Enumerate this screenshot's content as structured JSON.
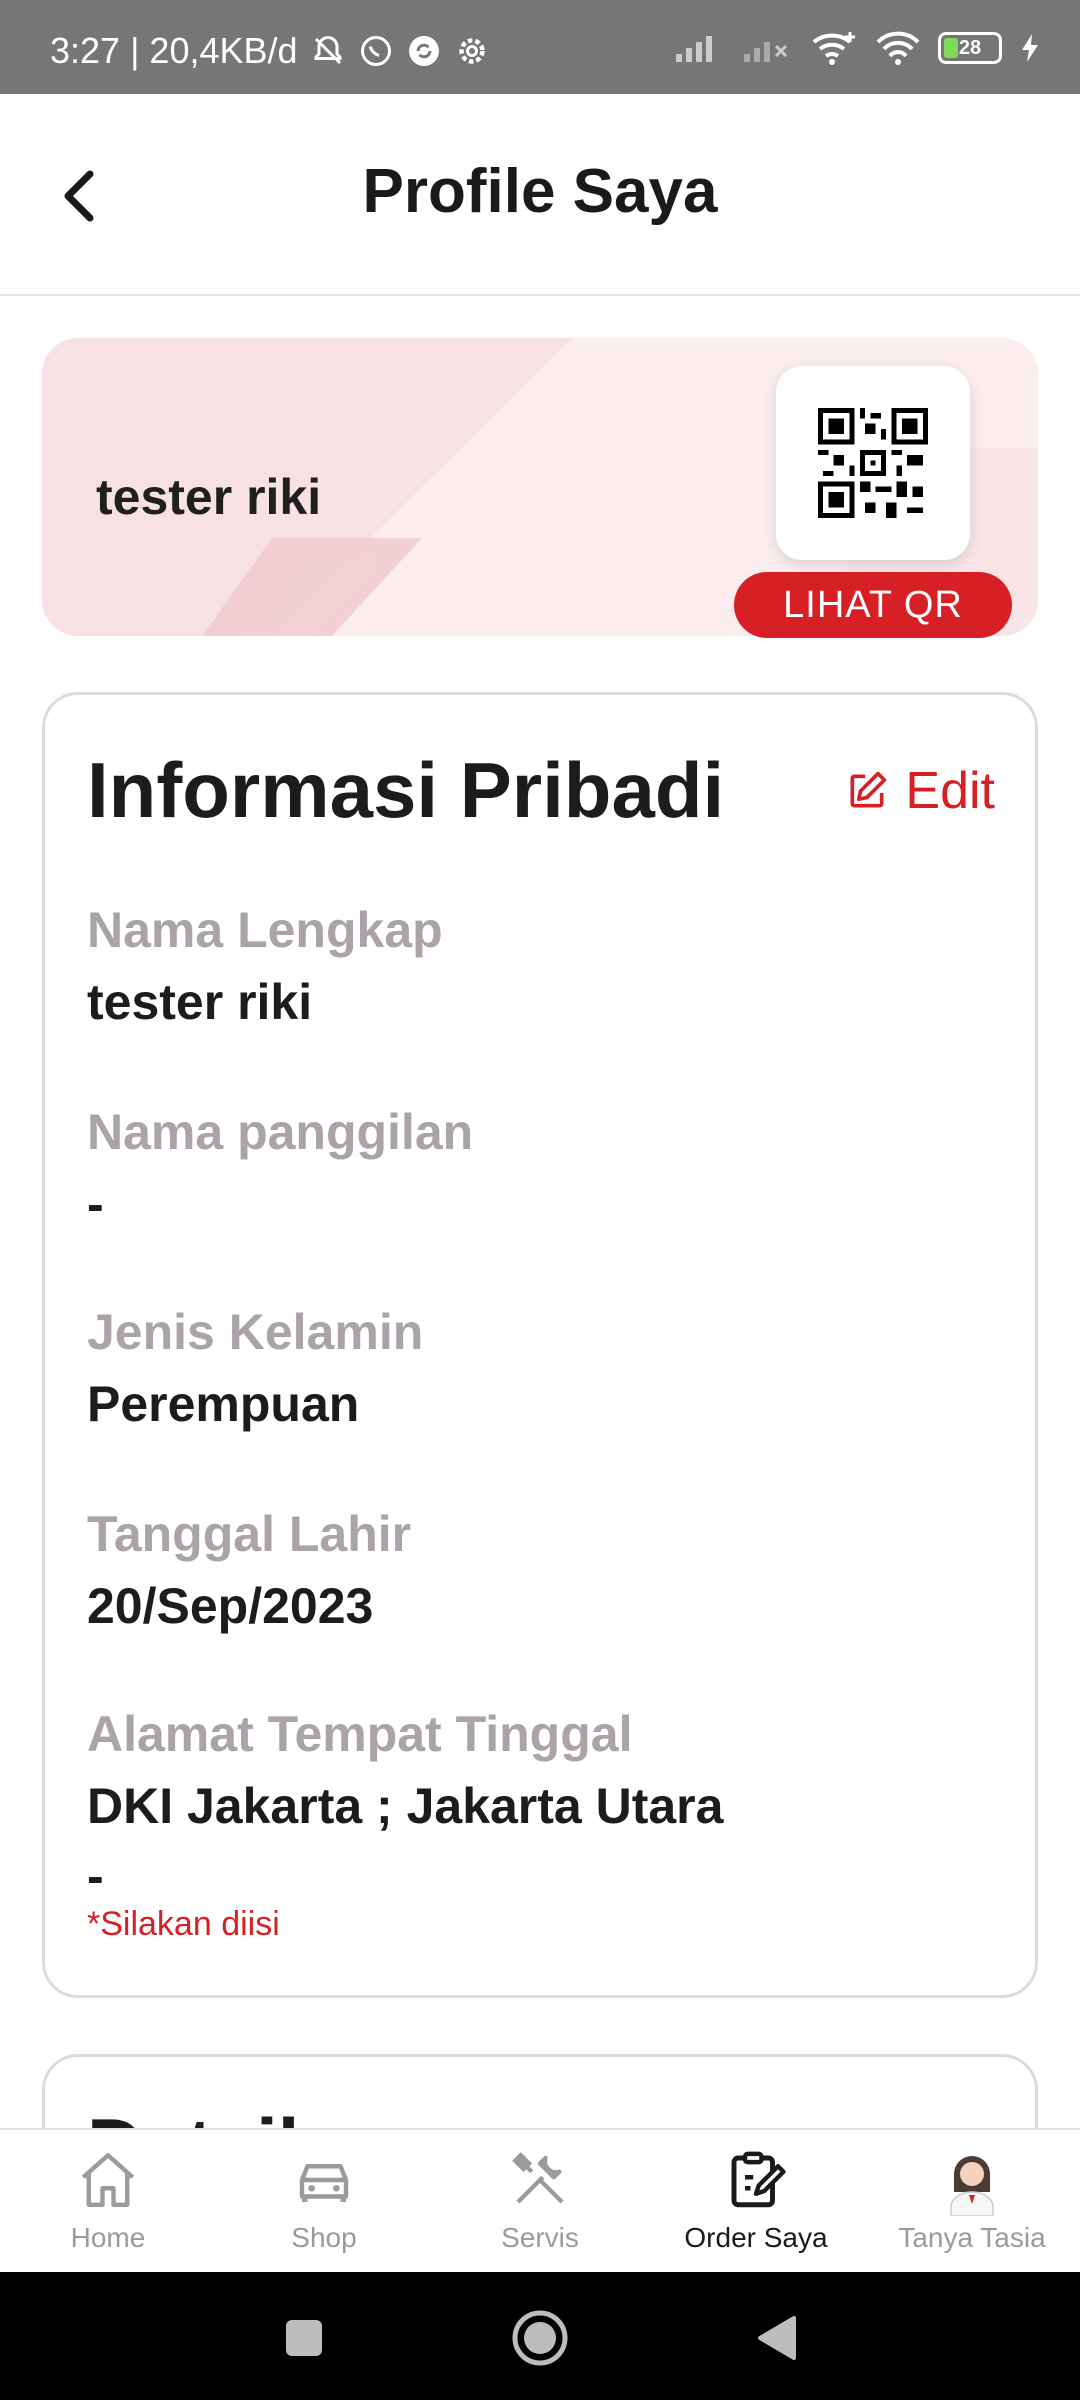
{
  "status_bar": {
    "time_speed": "3:27 | 20,4KB/d",
    "battery": "28"
  },
  "header": {
    "title": "Profile Saya"
  },
  "profile": {
    "name": "tester riki",
    "qr_button": "LIHAT QR"
  },
  "info": {
    "title": "Informasi Pribadi",
    "edit_label": "Edit",
    "fields": [
      {
        "label": "Nama Lengkap",
        "value": "tester riki"
      },
      {
        "label": "Nama panggilan",
        "value": "-"
      },
      {
        "label": "Jenis Kelamin",
        "value": "Perempuan"
      },
      {
        "label": "Tanggal Lahir",
        "value": "20/Sep/2023"
      },
      {
        "label": "Alamat Tempat Tinggal",
        "value": "DKI Jakarta ; Jakarta Utara",
        "value2": "-",
        "note": "*Silakan diisi"
      }
    ]
  },
  "detail": {
    "title": "Detail"
  },
  "bottom_nav": {
    "items": [
      {
        "label": "Home",
        "icon": "home-icon"
      },
      {
        "label": "Shop",
        "icon": "car-icon"
      },
      {
        "label": "Servis",
        "icon": "tools-icon"
      },
      {
        "label": "Order Saya",
        "icon": "order-icon",
        "active": true
      },
      {
        "label": "Tanya Tasia",
        "icon": "assistant-avatar"
      }
    ]
  },
  "colors": {
    "accent": "#d71f26",
    "label_gray": "#aaa3a8",
    "banner_bg": "#fbeced"
  }
}
